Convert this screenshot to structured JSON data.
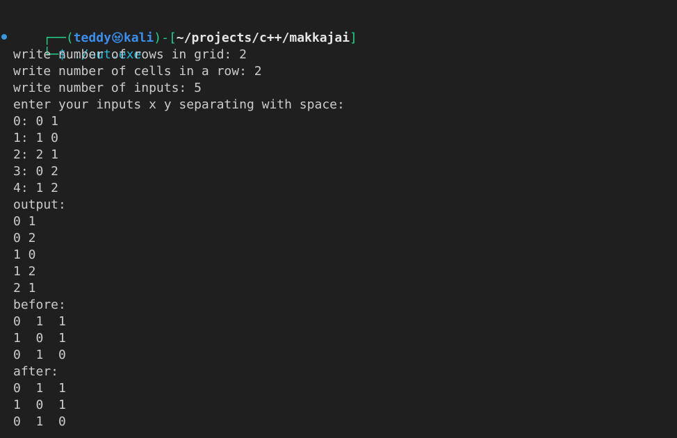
{
  "prompt": {
    "box_top_left": "┌──",
    "paren_open": "(",
    "user": "teddy",
    "host": "kali",
    "paren_close": ")",
    "dash_bracket_open": "-[",
    "path": "~/projects/c++/makkajai",
    "bracket_close": "]",
    "box_bottom_left": "└─",
    "dollar": "$",
    "command": " ./out.exe"
  },
  "output_lines": [
    "write number of rows in grid: 2",
    "write number of cells in a row: 2",
    "write number of inputs: 5",
    "enter your inputs x y separating with space:",
    "0: 0 1",
    "1: 1 0",
    "2: 2 1",
    "3: 0 2",
    "4: 1 2",
    "output:",
    "0 1",
    "0 2",
    "1 0",
    "1 2",
    "2 1",
    "before:",
    "0  1  1",
    "1  0  1",
    "0  1  0",
    "after:",
    "0  1  1",
    "1  0  1",
    "0  1  0"
  ],
  "colors": {
    "background": "#1f1f1f",
    "prompt_box": "#23d18b",
    "user_host": "#3b8eea",
    "command": "#29b8db",
    "decoration_dot": "#3a96dd"
  },
  "icons": {
    "user_host_separator": "kali-skull-icon",
    "status_dot": "command-decoration-dot-icon"
  }
}
